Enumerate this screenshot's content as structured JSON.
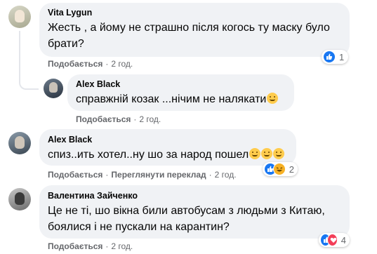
{
  "colors": {
    "bubble": "#f0f2f5",
    "secondary_text": "#65676b",
    "like": "#1877f2",
    "haha": "#f7b125",
    "love": "#f33e58"
  },
  "comments": [
    {
      "author": "Vita Lygun",
      "text_lines": [
        "Жесть , а йому не страшно після когось ту маску було",
        "брати?"
      ],
      "actions": {
        "like": "Подобається",
        "time": "2 год."
      },
      "reactions": {
        "icons": [
          "like-icon"
        ],
        "count": "1"
      }
    },
    {
      "author": "Alex Black",
      "text_lines": [
        "справжній козак ...нічим не налякати"
      ],
      "trailing_emoji": "thinking-face-icon",
      "actions": {
        "like": "Подобається",
        "time": "2 год."
      }
    },
    {
      "author": "Alex Black",
      "text_lines": [
        "спиз..ить хотел..ну шо за народ пошел"
      ],
      "trailing_emoji": [
        "grimacing-face-icon",
        "smirking-face-icon",
        "laughing-face-icon"
      ],
      "actions": {
        "like": "Подобається",
        "translate": "Переглянути переклад",
        "time": "2 год."
      },
      "reactions": {
        "icons": [
          "like-icon",
          "haha-icon"
        ],
        "count": "2"
      }
    },
    {
      "author": "Валентина Зайченко",
      "text_lines": [
        "Це не ті, шо вікна били автобусам з людьми з Китаю,",
        "боялися і не пускали на карантин?"
      ],
      "actions": {
        "like": "Подобається",
        "time": "2 год."
      },
      "reactions": {
        "icons": [
          "like-icon",
          "love-icon"
        ],
        "count": "4"
      }
    }
  ]
}
